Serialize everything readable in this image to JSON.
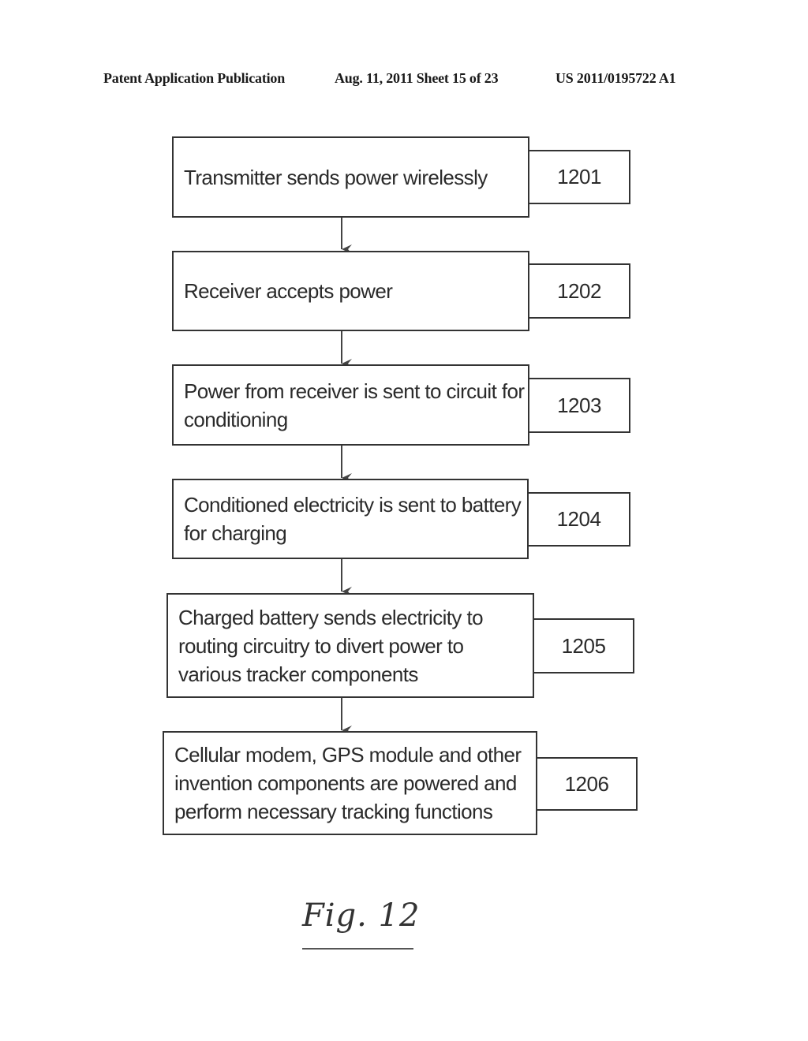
{
  "header": {
    "publication": "Patent Application Publication",
    "date_sheet": "Aug. 11, 2011  Sheet 15 of 23",
    "patent_number": "US 2011/0195722 A1"
  },
  "flowchart": {
    "steps": [
      {
        "ref": "1201",
        "lines": [
          "Transmitter sends power wirelessly"
        ]
      },
      {
        "ref": "1202",
        "lines": [
          "Receiver accepts power"
        ]
      },
      {
        "ref": "1203",
        "lines": [
          "Power from receiver is sent to circuit for",
          "conditioning"
        ]
      },
      {
        "ref": "1204",
        "lines": [
          "Conditioned electricity is sent to battery",
          "for charging"
        ]
      },
      {
        "ref": "1205",
        "lines": [
          "Charged battery sends electricity to",
          "routing circuitry to divert power to",
          "various tracker components"
        ]
      },
      {
        "ref": "1206",
        "lines": [
          "Cellular modem, GPS module and other",
          "invention components are powered and",
          "perform necessary tracking functions"
        ]
      }
    ],
    "edges": [
      {
        "from": "1201",
        "to": "1202"
      },
      {
        "from": "1202",
        "to": "1203"
      },
      {
        "from": "1203",
        "to": "1204"
      },
      {
        "from": "1204",
        "to": "1205"
      },
      {
        "from": "1205",
        "to": "1206"
      }
    ]
  },
  "figure_label": "Fig. 12"
}
